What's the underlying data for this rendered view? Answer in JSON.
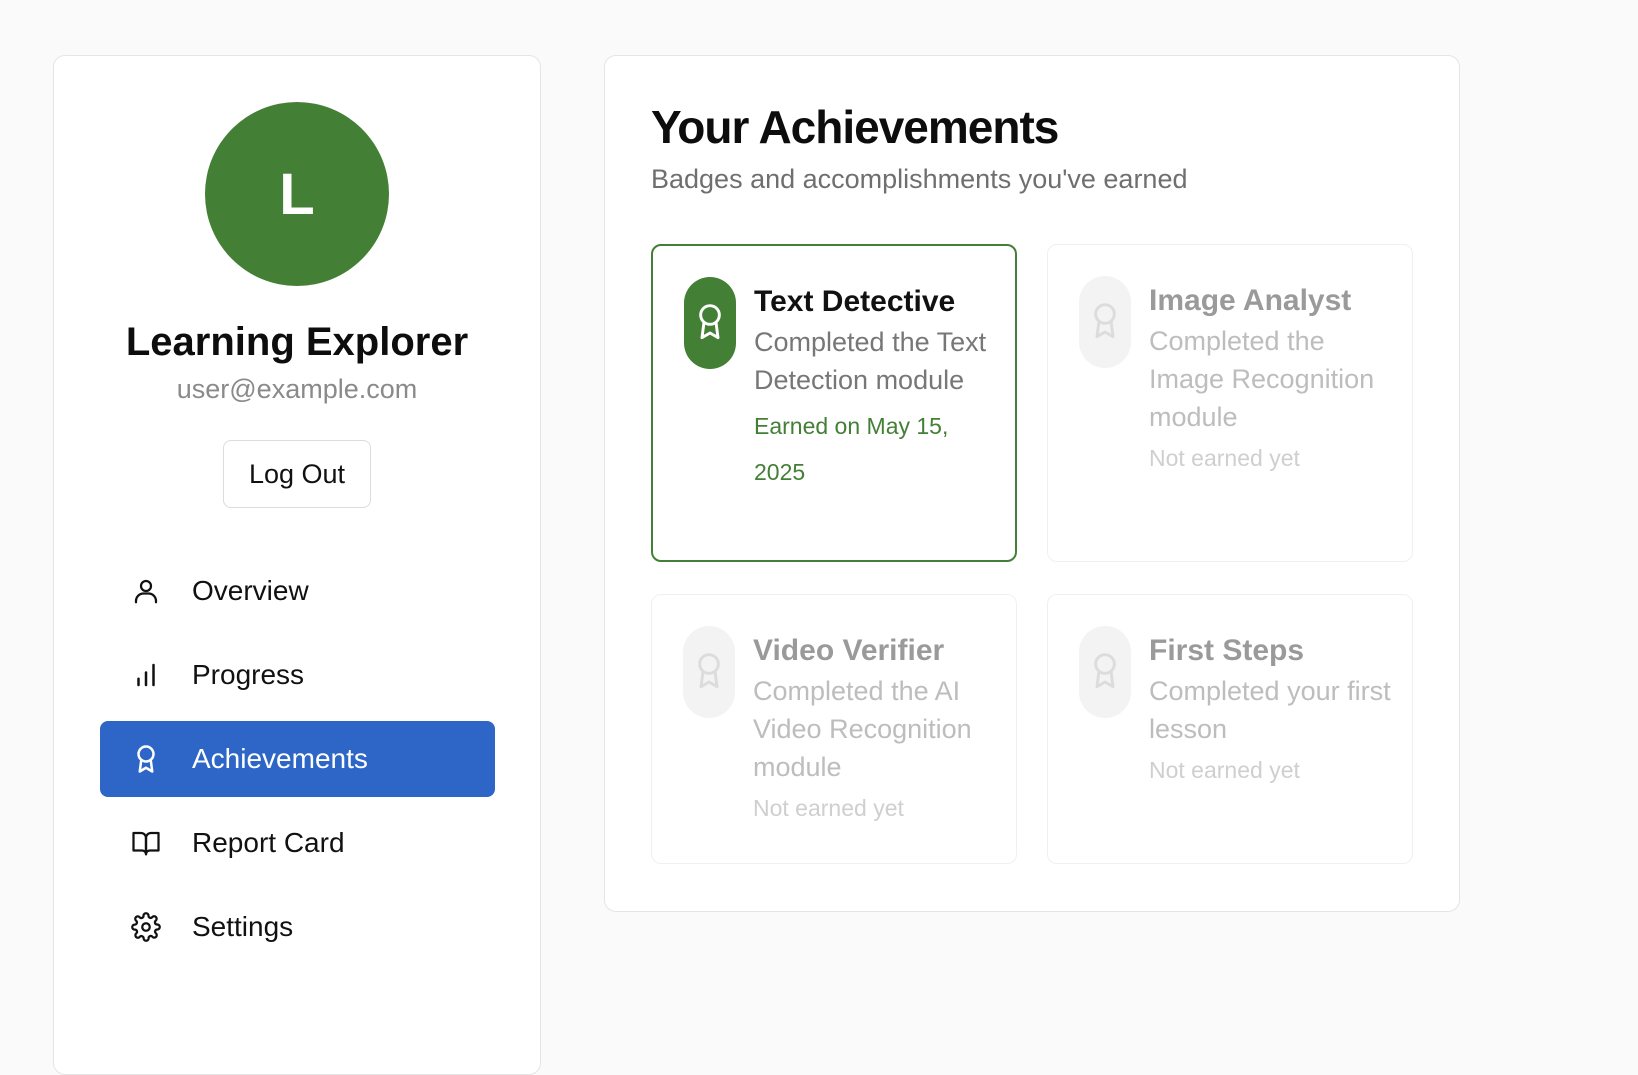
{
  "colors": {
    "accent": "#437f35",
    "nav_active": "#2e66c7"
  },
  "profile": {
    "avatar_initial": "L",
    "name": "Learning Explorer",
    "email": "user@example.com",
    "logout_label": "Log Out"
  },
  "nav": {
    "items": [
      {
        "label": "Overview",
        "icon": "user-icon"
      },
      {
        "label": "Progress",
        "icon": "bar-chart-icon"
      },
      {
        "label": "Achievements",
        "icon": "award-icon",
        "active": true
      },
      {
        "label": "Report Card",
        "icon": "book-open-icon"
      },
      {
        "label": "Settings",
        "icon": "gear-icon"
      }
    ]
  },
  "achievements": {
    "title": "Your Achievements",
    "subtitle": "Badges and accomplishments you've earned",
    "badges": [
      {
        "title": "Text Detective",
        "description": "Completed the Text Detection module",
        "status": "Earned on May 15, 2025",
        "earned": true,
        "icon": "award-icon"
      },
      {
        "title": "Image Analyst",
        "description": "Completed the Image Recognition module",
        "status": "Not earned yet",
        "earned": false,
        "icon": "award-icon"
      },
      {
        "title": "Video Verifier",
        "description": "Completed the AI Video Recognition module",
        "status": "Not earned yet",
        "earned": false,
        "icon": "award-icon"
      },
      {
        "title": "First Steps",
        "description": "Completed your first lesson",
        "status": "Not earned yet",
        "earned": false,
        "icon": "award-icon"
      }
    ]
  }
}
